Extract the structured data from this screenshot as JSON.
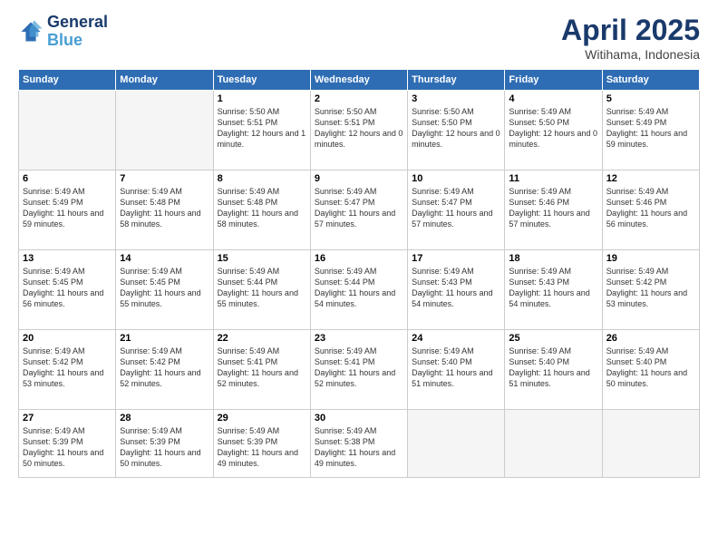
{
  "header": {
    "logo_line1": "General",
    "logo_line2": "Blue",
    "month": "April 2025",
    "location": "Witihama, Indonesia"
  },
  "weekdays": [
    "Sunday",
    "Monday",
    "Tuesday",
    "Wednesday",
    "Thursday",
    "Friday",
    "Saturday"
  ],
  "weeks": [
    [
      {
        "day": "",
        "content": ""
      },
      {
        "day": "",
        "content": ""
      },
      {
        "day": "1",
        "content": "Sunrise: 5:50 AM\nSunset: 5:51 PM\nDaylight: 12 hours\nand 1 minute."
      },
      {
        "day": "2",
        "content": "Sunrise: 5:50 AM\nSunset: 5:51 PM\nDaylight: 12 hours\nand 0 minutes."
      },
      {
        "day": "3",
        "content": "Sunrise: 5:50 AM\nSunset: 5:50 PM\nDaylight: 12 hours\nand 0 minutes."
      },
      {
        "day": "4",
        "content": "Sunrise: 5:49 AM\nSunset: 5:50 PM\nDaylight: 12 hours\nand 0 minutes."
      },
      {
        "day": "5",
        "content": "Sunrise: 5:49 AM\nSunset: 5:49 PM\nDaylight: 11 hours\nand 59 minutes."
      }
    ],
    [
      {
        "day": "6",
        "content": "Sunrise: 5:49 AM\nSunset: 5:49 PM\nDaylight: 11 hours\nand 59 minutes."
      },
      {
        "day": "7",
        "content": "Sunrise: 5:49 AM\nSunset: 5:48 PM\nDaylight: 11 hours\nand 58 minutes."
      },
      {
        "day": "8",
        "content": "Sunrise: 5:49 AM\nSunset: 5:48 PM\nDaylight: 11 hours\nand 58 minutes."
      },
      {
        "day": "9",
        "content": "Sunrise: 5:49 AM\nSunset: 5:47 PM\nDaylight: 11 hours\nand 57 minutes."
      },
      {
        "day": "10",
        "content": "Sunrise: 5:49 AM\nSunset: 5:47 PM\nDaylight: 11 hours\nand 57 minutes."
      },
      {
        "day": "11",
        "content": "Sunrise: 5:49 AM\nSunset: 5:46 PM\nDaylight: 11 hours\nand 57 minutes."
      },
      {
        "day": "12",
        "content": "Sunrise: 5:49 AM\nSunset: 5:46 PM\nDaylight: 11 hours\nand 56 minutes."
      }
    ],
    [
      {
        "day": "13",
        "content": "Sunrise: 5:49 AM\nSunset: 5:45 PM\nDaylight: 11 hours\nand 56 minutes."
      },
      {
        "day": "14",
        "content": "Sunrise: 5:49 AM\nSunset: 5:45 PM\nDaylight: 11 hours\nand 55 minutes."
      },
      {
        "day": "15",
        "content": "Sunrise: 5:49 AM\nSunset: 5:44 PM\nDaylight: 11 hours\nand 55 minutes."
      },
      {
        "day": "16",
        "content": "Sunrise: 5:49 AM\nSunset: 5:44 PM\nDaylight: 11 hours\nand 54 minutes."
      },
      {
        "day": "17",
        "content": "Sunrise: 5:49 AM\nSunset: 5:43 PM\nDaylight: 11 hours\nand 54 minutes."
      },
      {
        "day": "18",
        "content": "Sunrise: 5:49 AM\nSunset: 5:43 PM\nDaylight: 11 hours\nand 54 minutes."
      },
      {
        "day": "19",
        "content": "Sunrise: 5:49 AM\nSunset: 5:42 PM\nDaylight: 11 hours\nand 53 minutes."
      }
    ],
    [
      {
        "day": "20",
        "content": "Sunrise: 5:49 AM\nSunset: 5:42 PM\nDaylight: 11 hours\nand 53 minutes."
      },
      {
        "day": "21",
        "content": "Sunrise: 5:49 AM\nSunset: 5:42 PM\nDaylight: 11 hours\nand 52 minutes."
      },
      {
        "day": "22",
        "content": "Sunrise: 5:49 AM\nSunset: 5:41 PM\nDaylight: 11 hours\nand 52 minutes."
      },
      {
        "day": "23",
        "content": "Sunrise: 5:49 AM\nSunset: 5:41 PM\nDaylight: 11 hours\nand 52 minutes."
      },
      {
        "day": "24",
        "content": "Sunrise: 5:49 AM\nSunset: 5:40 PM\nDaylight: 11 hours\nand 51 minutes."
      },
      {
        "day": "25",
        "content": "Sunrise: 5:49 AM\nSunset: 5:40 PM\nDaylight: 11 hours\nand 51 minutes."
      },
      {
        "day": "26",
        "content": "Sunrise: 5:49 AM\nSunset: 5:40 PM\nDaylight: 11 hours\nand 50 minutes."
      }
    ],
    [
      {
        "day": "27",
        "content": "Sunrise: 5:49 AM\nSunset: 5:39 PM\nDaylight: 11 hours\nand 50 minutes."
      },
      {
        "day": "28",
        "content": "Sunrise: 5:49 AM\nSunset: 5:39 PM\nDaylight: 11 hours\nand 50 minutes."
      },
      {
        "day": "29",
        "content": "Sunrise: 5:49 AM\nSunset: 5:39 PM\nDaylight: 11 hours\nand 49 minutes."
      },
      {
        "day": "30",
        "content": "Sunrise: 5:49 AM\nSunset: 5:38 PM\nDaylight: 11 hours\nand 49 minutes."
      },
      {
        "day": "",
        "content": ""
      },
      {
        "day": "",
        "content": ""
      },
      {
        "day": "",
        "content": ""
      }
    ]
  ]
}
